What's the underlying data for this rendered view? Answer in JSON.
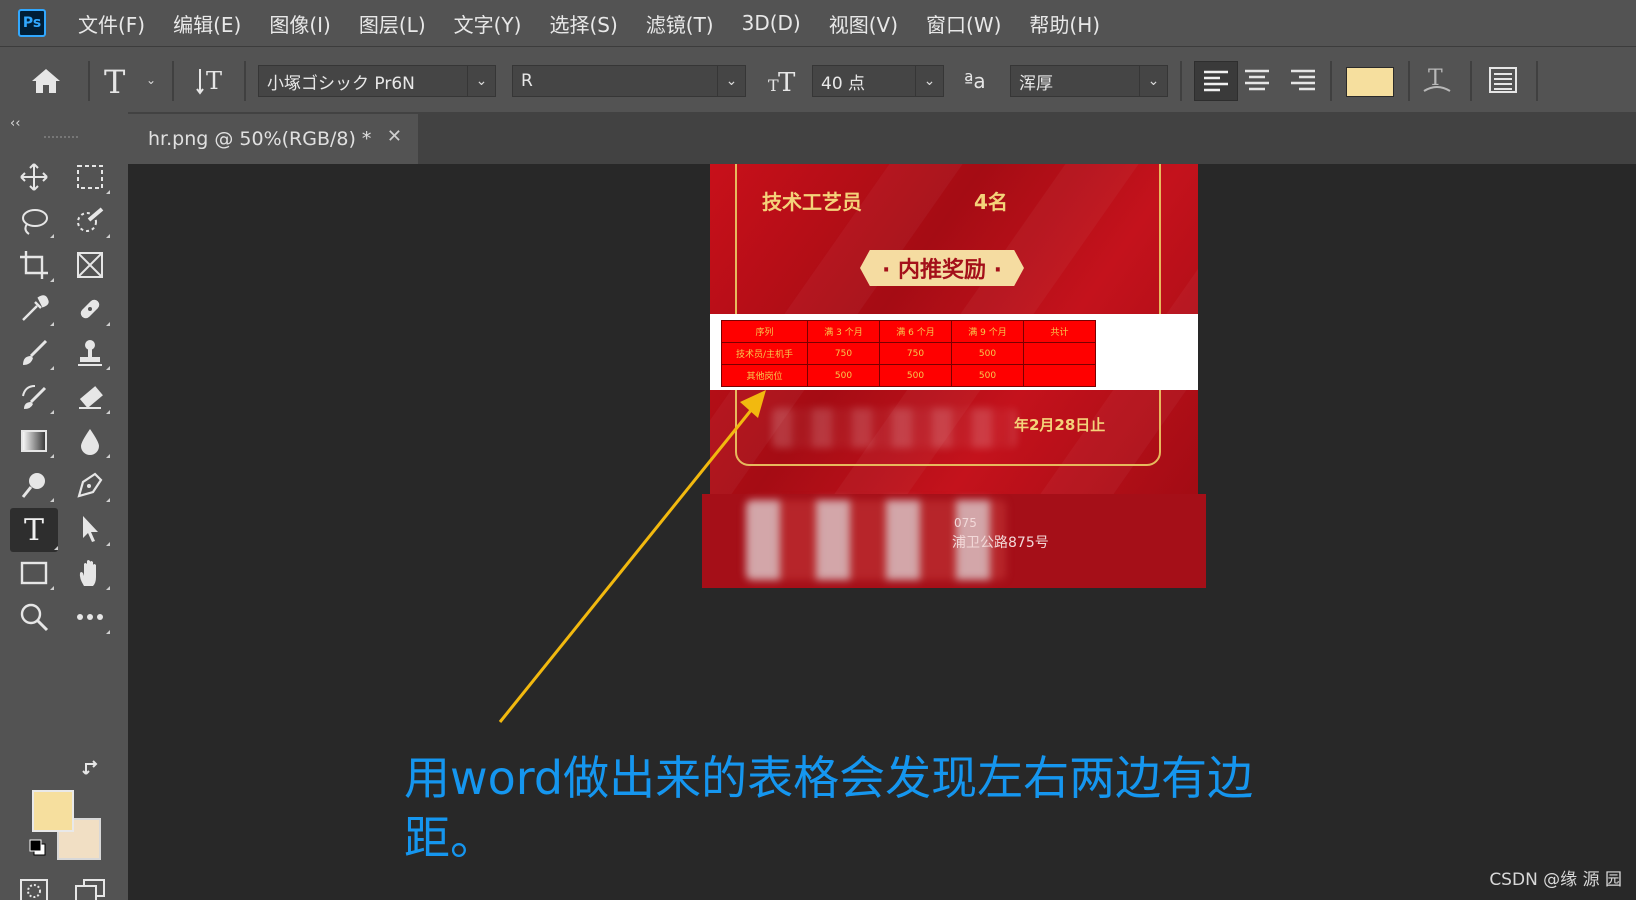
{
  "app": {
    "logo": "Ps"
  },
  "menu": [
    "文件(F)",
    "编辑(E)",
    "图像(I)",
    "图层(L)",
    "文字(Y)",
    "选择(S)",
    "滤镜(T)",
    "3D(D)",
    "视图(V)",
    "窗口(W)",
    "帮助(H)"
  ],
  "options": {
    "font_family": "小塚ゴシック Pr6N",
    "font_style": "R",
    "font_size": "40 点",
    "antialias_label": "ªa",
    "antialias": "浑厚",
    "text_color": "#f6df9e"
  },
  "tab": {
    "title": "hr.png @ 50%(RGB/8) *",
    "close": "✕"
  },
  "tools": {
    "collapse": "‹‹",
    "foreground_color": "#f6df9e",
    "background_color": "#f1dfc4"
  },
  "poster": {
    "position_title": "技术工艺员",
    "headcount": "4名",
    "badge": "· 内推奖励 ·",
    "deadline_suffix": "年2月28日止",
    "address_fragment_1": "075",
    "address_fragment_2": "浦卫公路875号",
    "table": {
      "headers": [
        "序列",
        "满 3 个月",
        "满 6 个月",
        "满 9 个月",
        "共计"
      ],
      "rows": [
        [
          "技术员/主机手",
          "750",
          "750",
          "500",
          ""
        ],
        [
          "其他岗位",
          "500",
          "500",
          "500",
          ""
        ]
      ]
    }
  },
  "annotation": "用word做出来的表格会发现左右两边有边距。",
  "watermark": "CSDN @缘 源 园"
}
